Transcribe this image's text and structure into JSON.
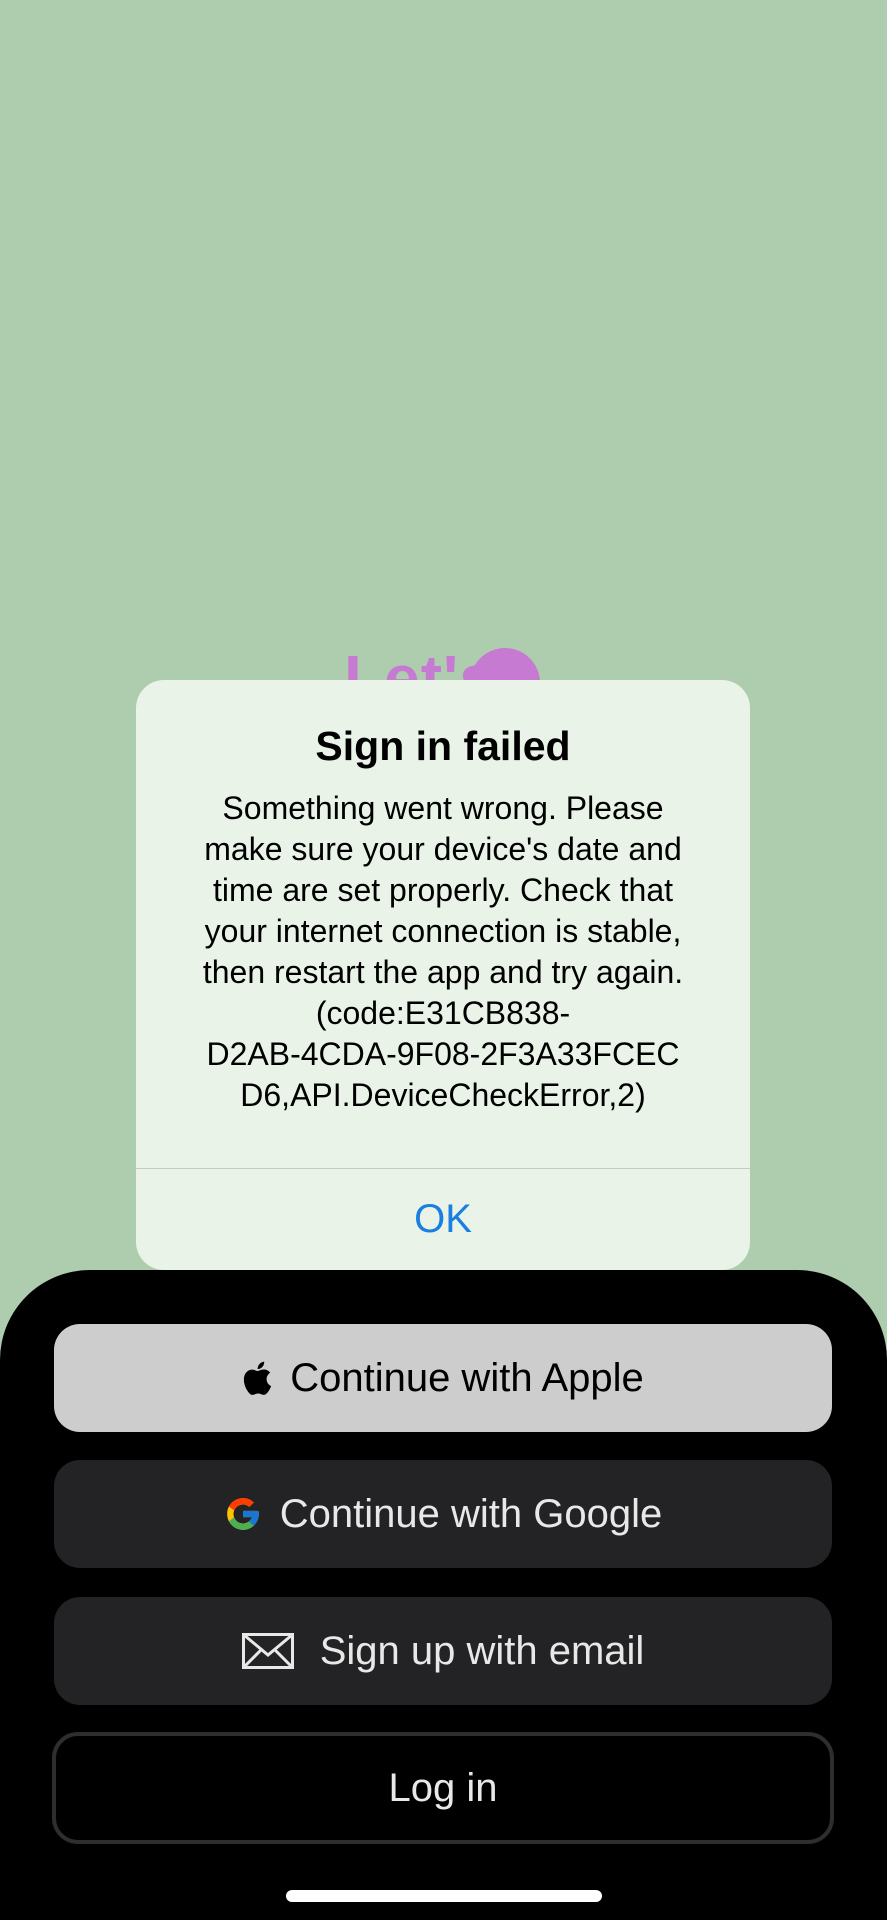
{
  "background": {
    "color": "#aecdae"
  },
  "logo": {
    "text": "Let's",
    "color": "#c77ad1"
  },
  "alert": {
    "title": "Sign in failed",
    "message": "Something went wrong. Please\nmake sure your device's date and\ntime are set properly. Check that\nyour internet connection is stable,\nthen restart the app and try again.\n(code:E31CB838-\nD2AB-4CDA-9F08-2F3A33FCEC\nD6,API.DeviceCheckError,2)",
    "ok_label": "OK",
    "ok_color": "#1a7fe0"
  },
  "auth": {
    "apple": {
      "label": "Continue with Apple",
      "icon": "apple-logo-icon"
    },
    "google": {
      "label": "Continue with Google",
      "icon": "google-logo-icon"
    },
    "email": {
      "label": "Sign up with email",
      "icon": "envelope-icon"
    },
    "login": {
      "label": "Log in"
    }
  }
}
